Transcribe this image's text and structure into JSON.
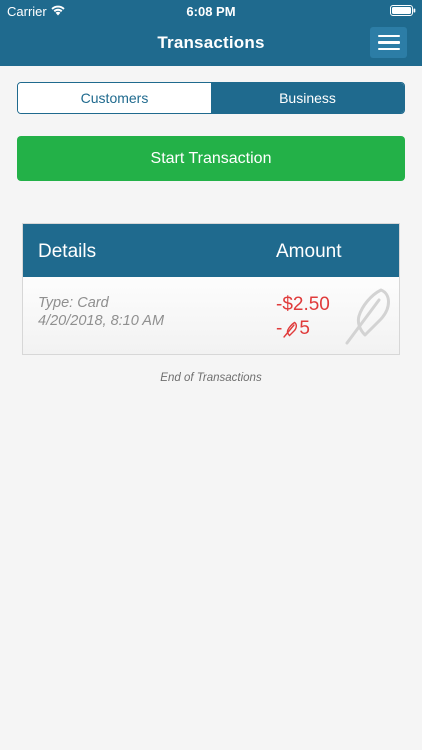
{
  "status_bar": {
    "carrier": "Carrier",
    "time": "6:08 PM",
    "wifi_icon": "wifi-icon",
    "battery_icon": "battery-icon"
  },
  "header": {
    "title": "Transactions",
    "menu_icon": "hamburger-menu-icon"
  },
  "segments": {
    "customers": "Customers",
    "business": "Business",
    "selected": "Business"
  },
  "start_button": {
    "label": "Start Transaction"
  },
  "table": {
    "columns": {
      "details": "Details",
      "amount": "Amount"
    },
    "rows": [
      {
        "type": "Type: Card",
        "date": "4/20/2018, 8:10 AM",
        "amount": "-$2.50",
        "points_sign": "-",
        "points_value": "5",
        "points_icon": "feather-icon"
      }
    ]
  },
  "end_text": "End of Transactions",
  "colors": {
    "header": "#1f6a8e",
    "start_button": "#23b148",
    "negative_amount": "#e03b3b"
  }
}
